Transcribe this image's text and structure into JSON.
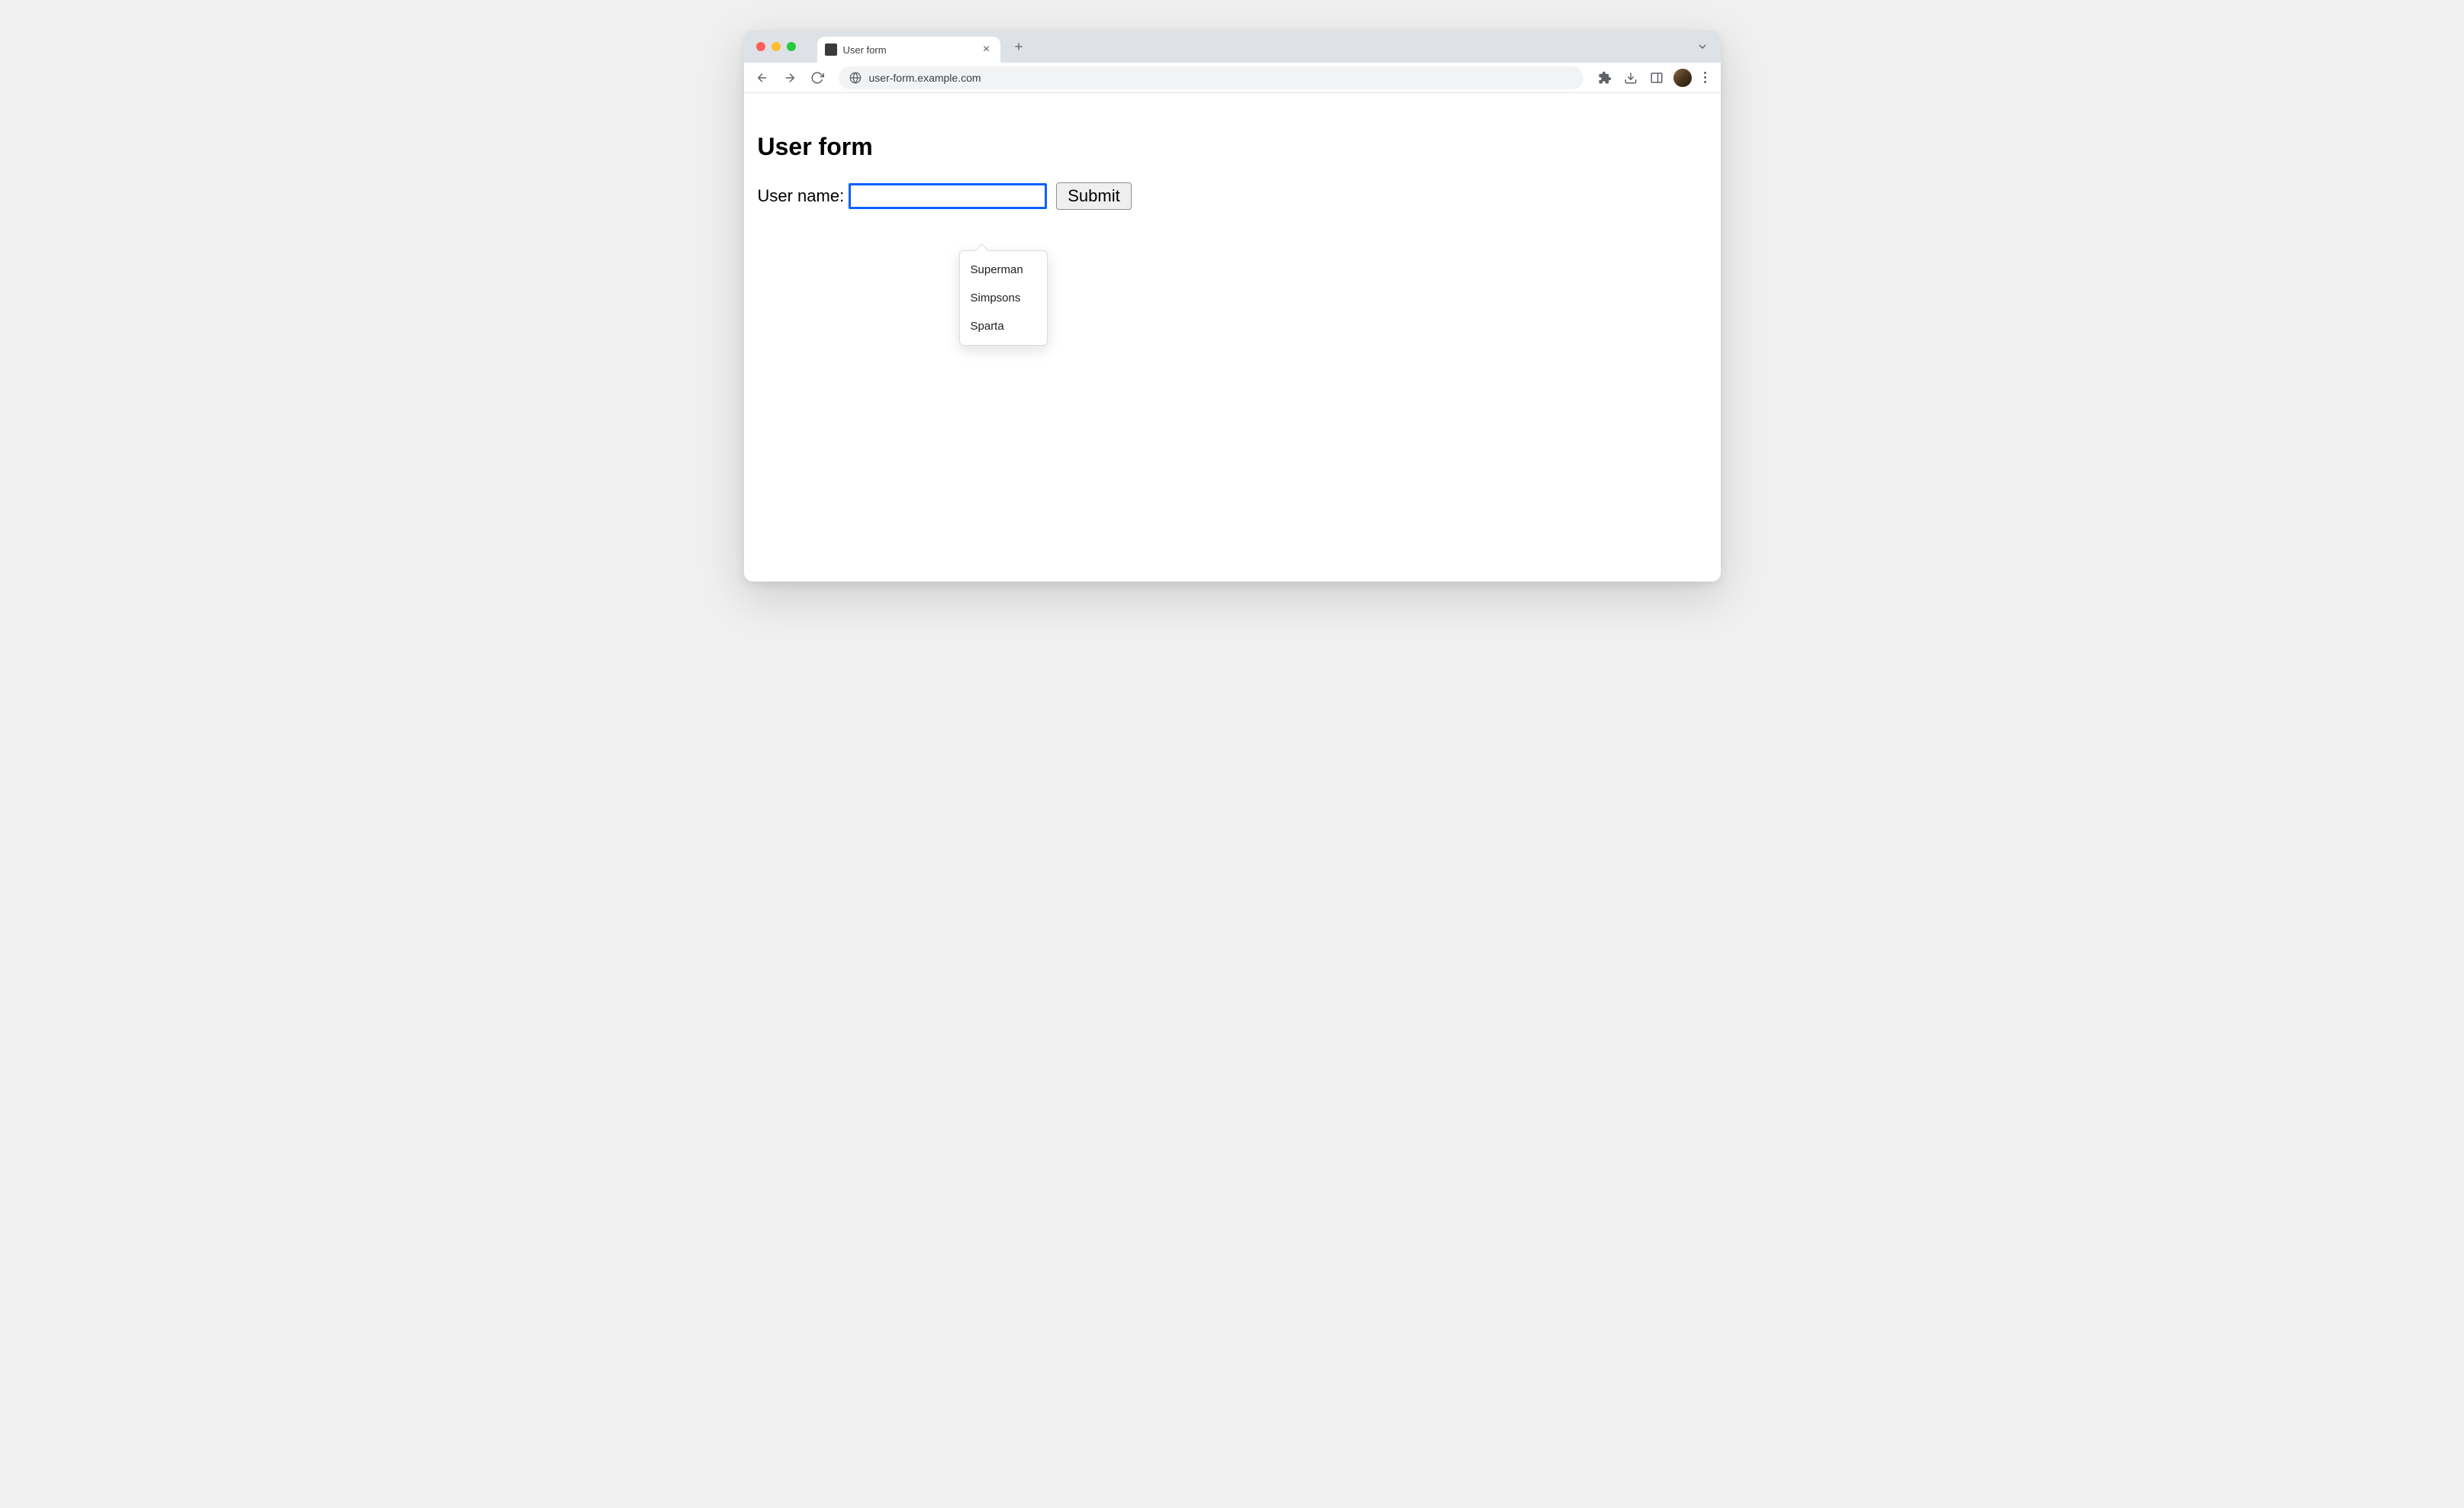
{
  "browser": {
    "tab_title": "User form",
    "url": "user-form.example.com"
  },
  "page": {
    "heading": "User form",
    "label": "User name:",
    "input_value": "",
    "input_placeholder": "",
    "submit_label": "Submit"
  },
  "autocomplete": {
    "items": [
      "Superman",
      "Simpsons",
      "Sparta"
    ]
  }
}
